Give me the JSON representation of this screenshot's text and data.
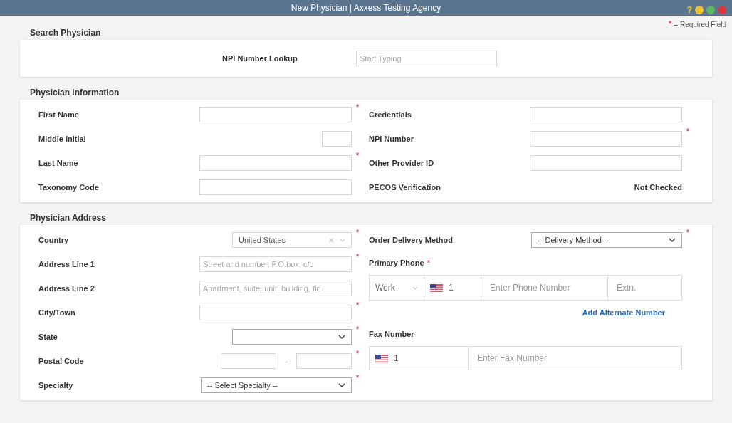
{
  "window": {
    "title": "New Physician | Axxess Testing Agency",
    "controls": [
      {
        "kind": "help",
        "label": "?"
      },
      {
        "kind": "minimize"
      },
      {
        "kind": "maximize"
      },
      {
        "kind": "close"
      }
    ]
  },
  "required_note": {
    "mark": "*",
    "text": "= Required Field"
  },
  "search_section": {
    "title": "Search Physician",
    "field": {
      "label": "NPI Number Lookup",
      "placeholder": "Start Typing"
    }
  },
  "info_section": {
    "title": "Physician Information",
    "left": [
      {
        "kind": "text",
        "label": "First Name",
        "required": true
      },
      {
        "kind": "short",
        "label": "Middle Initial",
        "required": false
      },
      {
        "kind": "text",
        "label": "Last Name",
        "required": true
      },
      {
        "kind": "text",
        "label": "Taxonomy Code",
        "required": false
      }
    ],
    "right": [
      {
        "kind": "text",
        "label": "Credentials",
        "required": false
      },
      {
        "kind": "text",
        "label": "NPI Number",
        "required": true
      },
      {
        "kind": "text",
        "label": "Other Provider ID",
        "required": false
      },
      {
        "kind": "status",
        "label": "PECOS Verification",
        "value": "Not Checked",
        "required": false
      }
    ]
  },
  "address_section": {
    "title": "Physician Address",
    "left": [
      {
        "kind": "combo",
        "label": "Country",
        "value": "United States",
        "required": true
      },
      {
        "kind": "text",
        "label": "Address Line 1",
        "placeholder": "Street and number, P.O.box, c/o",
        "required": true
      },
      {
        "kind": "text",
        "label": "Address Line 2",
        "placeholder": "Apartment, suite, unit, building, flo",
        "required": false
      },
      {
        "kind": "text",
        "label": "City/Town",
        "required": true
      },
      {
        "kind": "select",
        "label": "State",
        "required": true
      },
      {
        "kind": "postal",
        "label": "Postal Code",
        "separator": "-",
        "required": true
      },
      {
        "kind": "select",
        "label": "Specialty",
        "value": "-- Select Specialty --",
        "required": true
      }
    ],
    "right": [
      {
        "kind": "select",
        "label": "Order Delivery Method",
        "value": "-- Delivery Method --",
        "required": true
      },
      {
        "kind": "heading",
        "label": "Primary Phone",
        "required": true
      },
      {
        "kind": "phone",
        "type": "Work",
        "code": "1",
        "placeholder": "Enter Phone Number",
        "ext_placeholder": "Extn."
      },
      {
        "kind": "link",
        "label": "Add Alternate Number"
      },
      {
        "kind": "heading",
        "label": "Fax Number",
        "required": false
      },
      {
        "kind": "fax",
        "code": "1",
        "placeholder": "Enter Fax Number"
      }
    ]
  }
}
